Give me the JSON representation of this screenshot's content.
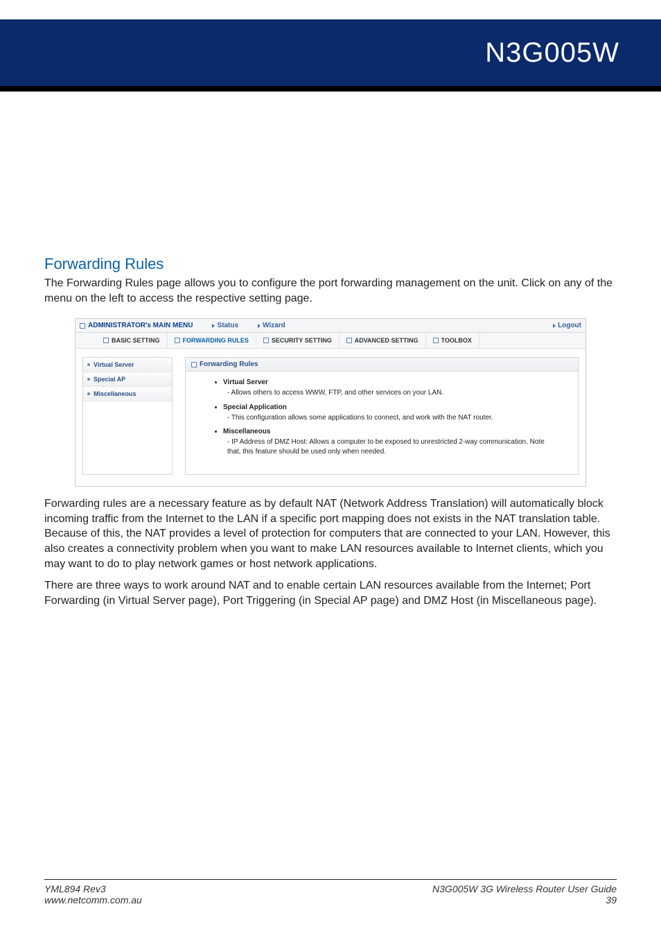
{
  "header": {
    "product": "N3G005W"
  },
  "section": {
    "title": "Forwarding Rules",
    "intro": "The Forwarding Rules page allows you to configure the port forwarding management on the unit. Click on any of the menu on the left to access the respective setting page."
  },
  "screenshot": {
    "topbar": {
      "main_menu": "ADMINISTRATOR's MAIN MENU",
      "status": "Status",
      "wizard": "Wizard",
      "logout": "Logout"
    },
    "tabs": {
      "basic": "BASIC SETTING",
      "forwarding": "FORWARDING RULES",
      "security": "SECURITY SETTING",
      "advanced": "ADVANCED SETTING",
      "toolbox": "TOOLBOX"
    },
    "sidebar": {
      "items": [
        {
          "label": "Virtual Server"
        },
        {
          "label": "Special AP"
        },
        {
          "label": "Miscellaneous"
        }
      ]
    },
    "panel": {
      "title": "Forwarding Rules",
      "bullets": [
        {
          "title": "Virtual Server",
          "desc": "- Allows others to access WWW, FTP, and other services on your LAN."
        },
        {
          "title": "Special Application",
          "desc": "- This configuration allows some applications to connect, and work with the NAT router."
        },
        {
          "title": "Miscellaneous",
          "desc": "- IP Address of DMZ Host: Allows a computer to be exposed to unrestricted 2-way communication. Note that, this feature should be used only when needed."
        }
      ]
    }
  },
  "para1": "Forwarding rules are a necessary feature as by default NAT (Network Address Translation) will automatically block incoming traffic from the Internet to the LAN if a specific port mapping does not exists in the NAT translation table. Because of this, the NAT provides a level of protection for computers that are connected to your LAN. However, this also creates a connectivity problem when you want to make LAN resources available to Internet clients, which you may want to do to play network games or host network applications.",
  "para2": "There are three ways to work around NAT and to enable certain LAN resources available from the Internet; Port Forwarding (in Virtual Server page), Port Triggering (in Special AP page) and DMZ Host (in Miscellaneous page).",
  "footer": {
    "rev": "YML894 Rev3",
    "url": "www.netcomm.com.au",
    "guide": "N3G005W 3G Wireless Router User Guide",
    "page": "39"
  }
}
